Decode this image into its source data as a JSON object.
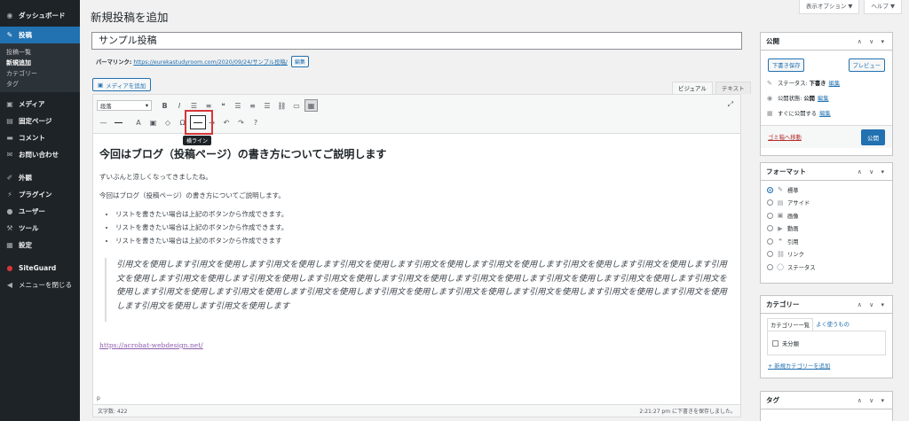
{
  "sidebar": {
    "items": [
      {
        "label": "ダッシュボード",
        "icon": "dashboard-icon",
        "glyph": "◉"
      },
      {
        "label": "投稿",
        "icon": "pin-icon",
        "glyph": "✎",
        "active": true
      },
      {
        "label": "メディア",
        "icon": "media-icon",
        "glyph": "▣"
      },
      {
        "label": "固定ページ",
        "icon": "page-icon",
        "glyph": "▤"
      },
      {
        "label": "コメント",
        "icon": "comment-icon",
        "glyph": "▬"
      },
      {
        "label": "お問い合わせ",
        "icon": "mail-icon",
        "glyph": "✉"
      },
      {
        "label": "外観",
        "icon": "appearance-icon",
        "glyph": "✐"
      },
      {
        "label": "プラグイン",
        "icon": "plugin-icon",
        "glyph": "⚡"
      },
      {
        "label": "ユーザー",
        "icon": "user-icon",
        "glyph": "●"
      },
      {
        "label": "ツール",
        "icon": "tool-icon",
        "glyph": "⚒"
      },
      {
        "label": "設定",
        "icon": "settings-icon",
        "glyph": "▦"
      },
      {
        "label": "SiteGuard",
        "icon": "siteguard-icon",
        "glyph": "●"
      },
      {
        "label": "メニューを閉じる",
        "icon": "collapse-icon",
        "glyph": "◀"
      }
    ],
    "sub_items": [
      "投稿一覧",
      "新規追加",
      "カテゴリー",
      "タグ"
    ],
    "current_sub": "新規追加"
  },
  "top_tabs": {
    "screen_options": "表示オプション ▼",
    "help": "ヘルプ ▼"
  },
  "page_title": "新規投稿を追加",
  "post_title": "サンプル投稿",
  "permalink": {
    "label": "パーマリンク:",
    "url": "https://eurekastudyroom.com/2020/09/24/サンプル投稿/",
    "edit_label": "編集"
  },
  "media_button": "メディアを追加",
  "editor_tabs": {
    "visual": "ビジュアル",
    "text": "テキスト"
  },
  "toolbar": {
    "format_select": "段落",
    "row1_icons": [
      {
        "name": "bold-icon",
        "glyph": "B"
      },
      {
        "name": "italic-icon",
        "glyph": "I"
      },
      {
        "name": "bullet-list-icon",
        "glyph": "☰"
      },
      {
        "name": "numbered-list-icon",
        "glyph": "≡"
      },
      {
        "name": "blockquote-icon",
        "glyph": "❝"
      },
      {
        "name": "align-left-icon",
        "glyph": "☰"
      },
      {
        "name": "align-center-icon",
        "glyph": "≡"
      },
      {
        "name": "align-right-icon",
        "glyph": "☰"
      },
      {
        "name": "link-icon",
        "glyph": "⛓"
      },
      {
        "name": "read-more-icon",
        "glyph": "▭"
      },
      {
        "name": "toolbar-toggle-icon",
        "glyph": "▦"
      }
    ],
    "row2_icons": [
      {
        "name": "text-color-icon",
        "glyph": "A"
      },
      {
        "name": "paste-text-icon",
        "glyph": "▣"
      },
      {
        "name": "clear-format-icon",
        "glyph": "◇"
      },
      {
        "name": "special-char-icon",
        "glyph": "Ω"
      },
      {
        "name": "outdent-icon",
        "glyph": "⇤"
      },
      {
        "name": "indent-icon",
        "glyph": "⇥"
      },
      {
        "name": "undo-icon",
        "glyph": "↶"
      },
      {
        "name": "redo-icon",
        "glyph": "↷"
      },
      {
        "name": "help-icon",
        "glyph": "?"
      }
    ],
    "tooltip": "横ライン"
  },
  "content": {
    "heading": "今回はブログ（投稿ページ）の書き方についてご説明します",
    "para1": "ずいぶんと涼しくなってきましたね。",
    "para2": "今回はブログ（投稿ページ）の書き方についてご説明します。",
    "list": [
      "リストを書きたい場合は上記のボタンから作成できます。",
      "リストを書きたい場合は上記のボタンから作成できます。",
      "リストを書きたい場合は上記のボタンから作成できます"
    ],
    "quote": "引用文を使用します引用文を使用します引用文を使用します引用文を使用します引用文を使用します引用文を使用します引用文を使用します引用文を使用します引用文を使用します引用文を使用します引用文を使用します引用文を使用します引用文を使用します引用文を使用します引用文を使用します引用文を使用します引用文を使用します引用文を使用します引用文を使用します引用文を使用します引用文を使用します引用文を使用します引用文を使用します引用文を使用します引用文を使用します引用文を使用します引用文を使用します",
    "link": "https://acrobat-webdesign.net/"
  },
  "editor_footer": {
    "path": "p",
    "word_count": "文字数: 422",
    "draft_saved": "2:21:27 pm に下書きを保存しました。"
  },
  "publish_box": {
    "title": "公開",
    "save_draft": "下書き保存",
    "preview": "プレビュー",
    "status_label": "ステータス:",
    "status_value": "下書き",
    "visibility_label": "公開状態:",
    "visibility_value": "公開",
    "schedule_label": "すぐに公開する",
    "edit": "編集",
    "trash": "ゴミ箱へ移動",
    "publish": "公開"
  },
  "format_box": {
    "title": "フォーマット",
    "options": [
      {
        "label": "標準",
        "icon": "pin-icon",
        "glyph": "✎",
        "selected": true
      },
      {
        "label": "アサイド",
        "icon": "aside-icon",
        "glyph": "▤"
      },
      {
        "label": "画像",
        "icon": "image-icon",
        "glyph": "▣"
      },
      {
        "label": "動画",
        "icon": "video-icon",
        "glyph": "▶"
      },
      {
        "label": "引用",
        "icon": "quote-icon",
        "glyph": "❝"
      },
      {
        "label": "リンク",
        "icon": "link-icon",
        "glyph": "⛓"
      },
      {
        "label": "ステータス",
        "icon": "status-icon",
        "glyph": "◯"
      }
    ]
  },
  "category_box": {
    "title": "カテゴリー",
    "tab_all": "カテゴリー一覧",
    "tab_popular": "よく使うもの",
    "items": [
      "未分類"
    ],
    "add_new": "+ 新規カテゴリーを追加"
  },
  "tag_box": {
    "title": "タグ"
  }
}
